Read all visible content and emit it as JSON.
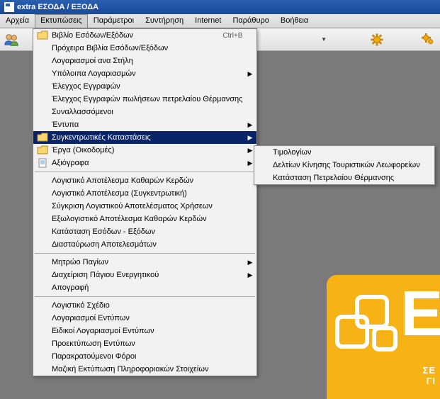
{
  "window": {
    "title": "extra ΕΣΟΔΑ / ΕΞΟΔΑ"
  },
  "menubar": {
    "items": [
      "Αρχεία",
      "Εκτυπώσεις",
      "Παράμετροι",
      "Συντήρηση",
      "Internet",
      "Παράθυρο",
      "Βοήθεια"
    ],
    "activeIndex": 1
  },
  "toolbar": {
    "dropdown_caret": "▼"
  },
  "menu": {
    "items": [
      {
        "label": "Βιβλίο Εσόδων/Εξόδων",
        "shortcut": "Ctrl+B",
        "icon": "folder"
      },
      {
        "label": "Πρόχειρα Βιβλία Εσόδων/Εξόδων"
      },
      {
        "label": "Λογαριασμοί ανα Στήλη"
      },
      {
        "label": "Υπόλοιπα Λογαριασμών",
        "arrow": true
      },
      {
        "label": "Έλεγχος Εγγραφών"
      },
      {
        "label": "Έλεγχος Εγγραφών πωλήσεων πετρελαίου Θέρμανσης"
      },
      {
        "label": "Συναλλασσόμενοι"
      },
      {
        "label": "Έντυπα",
        "arrow": true
      },
      {
        "label": "Συγκεντρωτικές Καταστάσεις",
        "arrow": true,
        "highlight": true,
        "icon": "folder"
      },
      {
        "label": "Έργα (Οικοδομές)",
        "arrow": true,
        "icon": "folder"
      },
      {
        "label": "Αξιόγραφα",
        "arrow": true,
        "icon": "doc"
      },
      {
        "sep": true
      },
      {
        "label": "Λογιστικό Αποτέλεσμα Καθαρών Κερδών"
      },
      {
        "label": "Λογιστικό Αποτέλεσμα (Συγκεντρωτική)"
      },
      {
        "label": "Σύγκριση Λογιστικού Αποτελέσματος Χρήσεων"
      },
      {
        "label": "Εξωλογιστικό Αποτέλεσμα Καθαρών Κερδών"
      },
      {
        "label": "Κατάσταση Εσόδων - Εξόδων"
      },
      {
        "label": "Διασταύρωση Αποτελεσμάτων"
      },
      {
        "sep": true
      },
      {
        "label": "Μητρώο Παγίων",
        "arrow": true
      },
      {
        "label": "Διαχείριση Πάγιου Ενεργητικού",
        "arrow": true
      },
      {
        "label": "Απογραφή"
      },
      {
        "sep": true
      },
      {
        "label": "Λογιστικό Σχέδιο"
      },
      {
        "label": "Λογαριασμοί Εντύπων"
      },
      {
        "label": "Ειδικοί Λογαριασμοί Εντύπων"
      },
      {
        "label": "Προεκτύπωση Εντύπων"
      },
      {
        "label": "Παρακρατούμενοι Φόροι"
      },
      {
        "label": "Μαζική Εκτύπωση Πληροφοριακών Στοιχείων"
      }
    ]
  },
  "submenu": {
    "items": [
      {
        "label": "Τιμολογίων"
      },
      {
        "label": "Δελτίων Κίνησης Τουριστικών Λεωφορείων"
      },
      {
        "label": "Κατάσταση Πετρελαίου Θέρμανσης"
      }
    ]
  },
  "logo": {
    "letter": "E",
    "line1": "ΣΕ",
    "line2": "ΓΙ"
  }
}
